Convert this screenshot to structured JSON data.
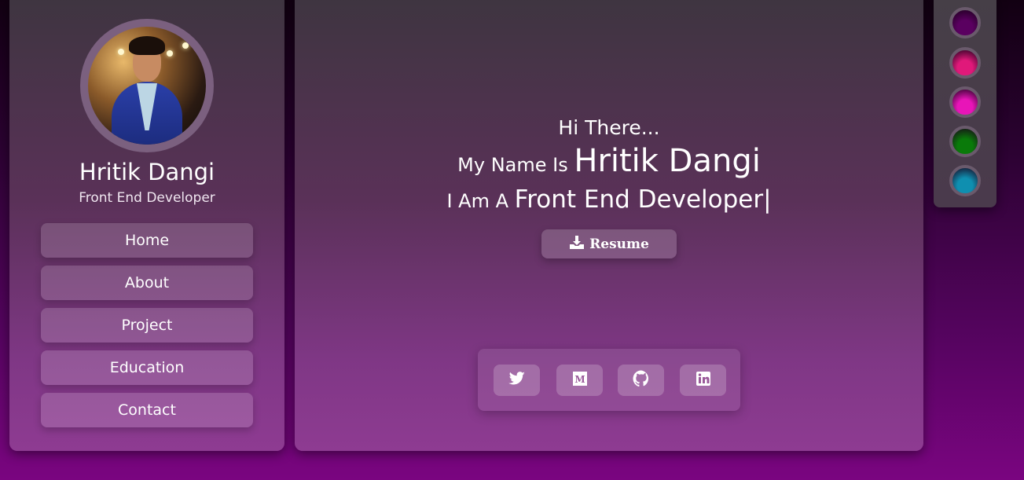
{
  "profile": {
    "name": "Hritik Dangi",
    "role": "Front End Developer"
  },
  "nav": {
    "items": [
      {
        "label": "Home"
      },
      {
        "label": "About"
      },
      {
        "label": "Project"
      },
      {
        "label": "Education"
      },
      {
        "label": "Contact"
      }
    ]
  },
  "hero": {
    "greeting": "Hi There...",
    "name_prefix": "My Name Is",
    "name": "Hritik Dangi",
    "role_prefix": "I Am A",
    "role_typed": "Front End Developer|",
    "resume_label": "Resume"
  },
  "social": {
    "icons": [
      "twitter-icon",
      "medium-icon",
      "github-icon",
      "linkedin-icon"
    ]
  },
  "theme": {
    "swatches": [
      {
        "name": "purple",
        "color": "#5a0060"
      },
      {
        "name": "pink",
        "color": "#e0197a"
      },
      {
        "name": "magenta",
        "color": "#e815b8"
      },
      {
        "name": "green",
        "color": "#0a7a0a"
      },
      {
        "name": "teal",
        "color": "#0f8fb0"
      }
    ]
  }
}
